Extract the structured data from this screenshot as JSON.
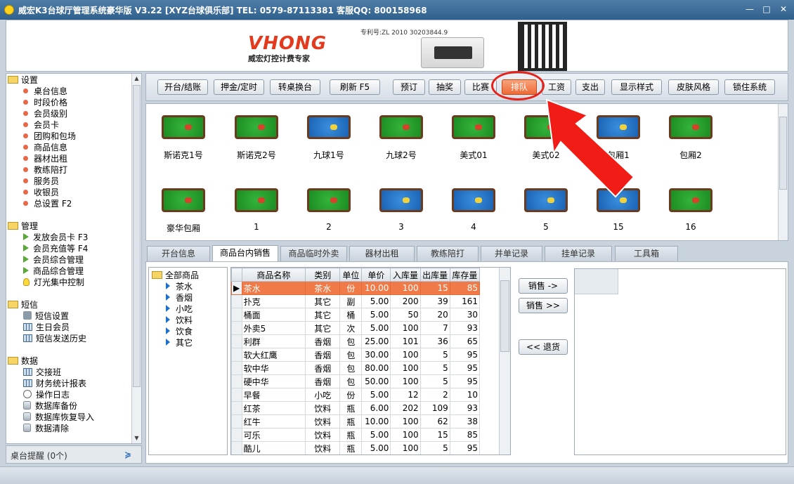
{
  "window": {
    "title": "威宏K3台球厅管理系统豪华版 V3.22   [XYZ台球俱乐部]   TEL: 0579-87113381 客服QQ: 800158968",
    "minimize": "—",
    "maximize": "□",
    "close": "✕"
  },
  "banner": {
    "logo": "VHONG",
    "slogan": "威宏灯控计费专家",
    "patent": "专利号:ZL 2010 30203844.9"
  },
  "sidebar": {
    "groups": [
      {
        "title": "设置",
        "items": [
          "桌台信息",
          "时段价格",
          "会员级别",
          "会员卡",
          "团购和包场",
          "商品信息",
          "器材出租",
          "教练陪打",
          "服务员",
          "收银员",
          "总设置 F2"
        ]
      },
      {
        "title": "管理",
        "items": [
          "发放会员卡 F3",
          "会员充值等 F4",
          "会员综合管理",
          "商品综合管理",
          "灯光集中控制"
        ]
      },
      {
        "title": "短信",
        "items": [
          "短信设置",
          "生日会员",
          "短信发送历史"
        ]
      },
      {
        "title": "数据",
        "items": [
          "交接班",
          "财务统计报表",
          "操作日志",
          "数据库备份",
          "数据库恢复导入",
          "数据清除"
        ]
      }
    ],
    "footer": "桌台提醒 (0个)",
    "footer_chevron": "≽"
  },
  "toolbar": {
    "buttons": [
      "开台/结账",
      "押金/定时",
      "转桌换台",
      "刷新 F5",
      "预订",
      "抽奖",
      "比赛",
      "排队",
      "工资",
      "支出",
      "显示样式",
      "皮肤风格",
      "锁住系统"
    ]
  },
  "tables": [
    {
      "name": "斯诺克1号",
      "color": "green"
    },
    {
      "name": "斯诺克2号",
      "color": "green"
    },
    {
      "name": "九球1号",
      "color": "blue"
    },
    {
      "name": "九球2号",
      "color": "green"
    },
    {
      "name": "美式01",
      "color": "green"
    },
    {
      "name": "美式02",
      "color": "green"
    },
    {
      "name": "包厢1",
      "color": "blue"
    },
    {
      "name": "包厢2",
      "color": "green"
    },
    {
      "name": "豪华包厢",
      "color": "green"
    },
    {
      "name": "1",
      "color": "green"
    },
    {
      "name": "2",
      "color": "green"
    },
    {
      "name": "3",
      "color": "blue"
    },
    {
      "name": "4",
      "color": "blue"
    },
    {
      "name": "5",
      "color": "blue"
    },
    {
      "name": "15",
      "color": "blue"
    },
    {
      "name": "16",
      "color": "green"
    }
  ],
  "tabs": [
    "开台信息",
    "商品台内销售",
    "商品临时外卖",
    "器材出租",
    "教练陪打",
    "并单记录",
    "挂单记录",
    "工具箱"
  ],
  "categories": {
    "root": "全部商品",
    "items": [
      "茶水",
      "香烟",
      "小吃",
      "饮料",
      "饮食",
      "其它"
    ]
  },
  "products": {
    "columns": [
      "商品名称",
      "类别",
      "单位",
      "单价",
      "入库量",
      "出库量",
      "库存量"
    ],
    "rows": [
      [
        "茶水",
        "茶水",
        "份",
        "10.00",
        "100",
        "15",
        "85"
      ],
      [
        "扑克",
        "其它",
        "副",
        "5.00",
        "200",
        "39",
        "161"
      ],
      [
        "桶面",
        "其它",
        "桶",
        "5.00",
        "50",
        "20",
        "30"
      ],
      [
        "外卖5",
        "其它",
        "次",
        "5.00",
        "100",
        "7",
        "93"
      ],
      [
        "利群",
        "香烟",
        "包",
        "25.00",
        "101",
        "36",
        "65"
      ],
      [
        "软大红鹰",
        "香烟",
        "包",
        "30.00",
        "100",
        "5",
        "95"
      ],
      [
        "软中华",
        "香烟",
        "包",
        "80.00",
        "100",
        "5",
        "95"
      ],
      [
        "硬中华",
        "香烟",
        "包",
        "50.00",
        "100",
        "5",
        "95"
      ],
      [
        "早餐",
        "小吃",
        "份",
        "5.00",
        "12",
        "2",
        "10"
      ],
      [
        "红茶",
        "饮料",
        "瓶",
        "6.00",
        "202",
        "109",
        "93"
      ],
      [
        "红牛",
        "饮料",
        "瓶",
        "10.00",
        "100",
        "62",
        "38"
      ],
      [
        "可乐",
        "饮料",
        "瓶",
        "5.00",
        "100",
        "15",
        "85"
      ],
      [
        "酷儿",
        "饮料",
        "瓶",
        "5.00",
        "100",
        "5",
        "95"
      ]
    ],
    "selected_row": 0
  },
  "actions": {
    "sell_one": "销售 ->",
    "sell_all": "销售 >>",
    "return": "<< 退货"
  },
  "colors": {
    "accent": "#ee6a36",
    "highlight": "#e8221b"
  }
}
